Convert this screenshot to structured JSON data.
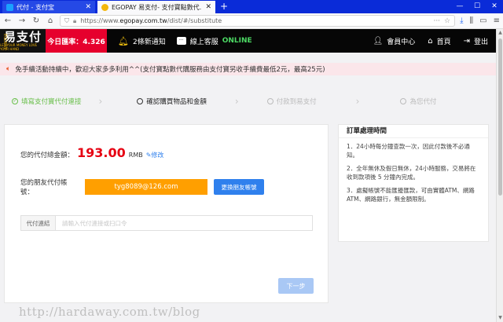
{
  "browser": {
    "tabs": [
      {
        "title": "代付 - 支付宝",
        "active": false
      },
      {
        "title": "EGOPAY 易支付- 支付寶點數代…",
        "active": true
      }
    ],
    "new_tab_label": "+",
    "url_prefix": "https://www.",
    "url_domain": "egopay.com.tw",
    "url_path": "/dist/#/substitute"
  },
  "header": {
    "logo_text": "易支付",
    "logo_tagline": "LET YOUR MONEY LOVE YOUR HAND",
    "logo_side": "EGOPAY",
    "rate_label": "今日匯率：4.326",
    "notifications": "2條新通知",
    "support_label": "線上客服",
    "support_status": "ONLINE",
    "member_center": "會員中心",
    "home": "首頁",
    "logout": "登出"
  },
  "notice": {
    "text": "免手續活動持續中，歡迎大家多多利用^^(支付寶點數代購服務由支付寶另收手續費最低2元，最高25元)"
  },
  "steps": [
    {
      "label": "填寫支付寶代付連接",
      "state": "done"
    },
    {
      "label": "確認購買物品和金額",
      "state": "current"
    },
    {
      "label": "付款到易支付",
      "state": "todo"
    },
    {
      "label": "為您代付",
      "state": "todo"
    }
  ],
  "form": {
    "total_label": "您的代付總金額：",
    "total_amount": "193.00",
    "currency": "RMB",
    "edit_label": "修改",
    "friend_label": "您的朋友代付帳號：",
    "friend_account": "tyg8089@126.com",
    "swap_button": "更換朋友帳號",
    "link_label": "代付連結",
    "link_placeholder": "請輸入代付連接或扫口令",
    "next_button": "下一步"
  },
  "side": {
    "title": "訂單處理時間",
    "items": [
      "1．24小時每分鐘查款一次，因此付款後不必通知。",
      "2．全年無休及假日無休，24小時服務，交易將在收到款項後 5 分鐘內完成。",
      "3．處擬帳號不能匯擾匯款，可由實體ATM、網路ATM、網路銀行，無金額限制。"
    ]
  },
  "watermark": "http://hardaway.com.tw/blog",
  "colors": {
    "accent": "#e6002d",
    "amount": "#e60012",
    "account_box": "#ff9f00",
    "primary_button": "#2f80ed",
    "done_step": "#6abf4b"
  }
}
